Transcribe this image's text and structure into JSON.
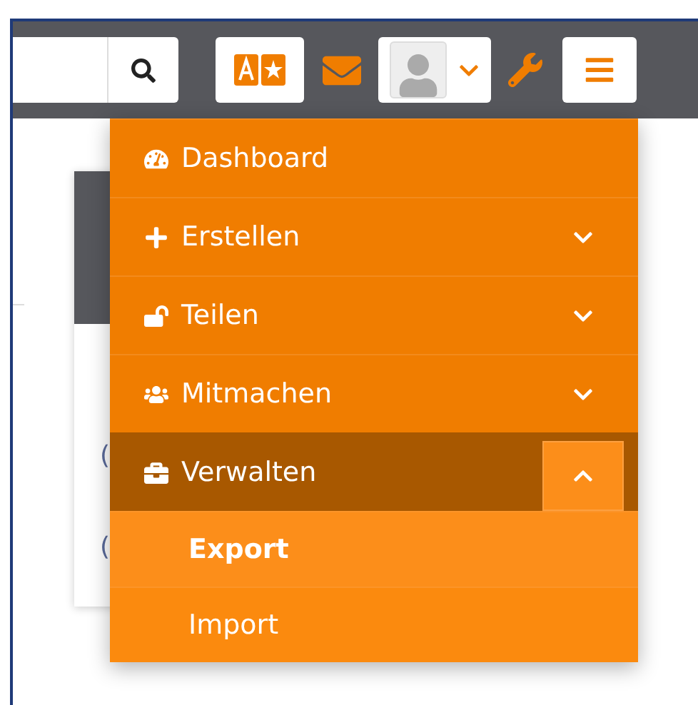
{
  "card": {
    "lines": [
      "(",
      "("
    ]
  },
  "menu": {
    "items": [
      {
        "label": "Dashboard",
        "selected": false
      },
      {
        "label": "Erstellen",
        "expanded": false,
        "selected": false
      },
      {
        "label": "Teilen",
        "expanded": false,
        "selected": false
      },
      {
        "label": "Mitmachen",
        "expanded": false,
        "selected": false
      },
      {
        "label": "Verwalten",
        "expanded": true,
        "selected": true,
        "children": [
          {
            "label": "Export",
            "selected": true
          },
          {
            "label": "Import",
            "selected": false
          }
        ]
      }
    ]
  }
}
